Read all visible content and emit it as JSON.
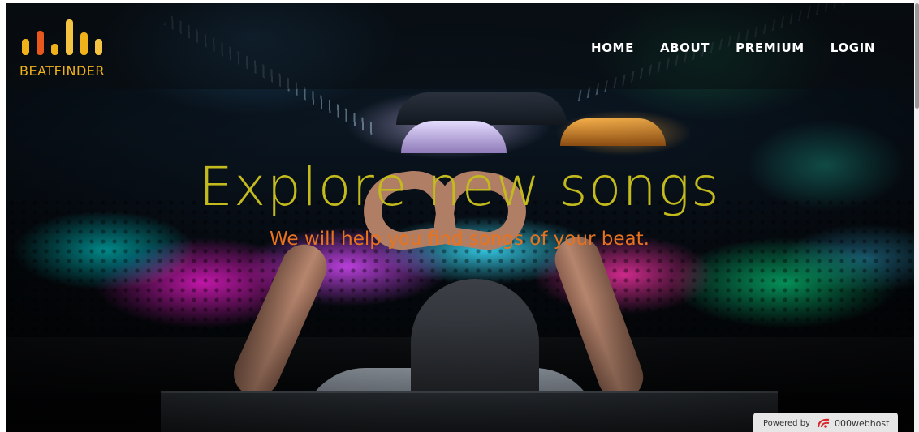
{
  "brand": {
    "name": "BEATFINDER",
    "colors": [
      "#f0b21a",
      "#e8581c",
      "#f0b21a",
      "#f5c342",
      "#f0b21a",
      "#f5c342"
    ],
    "icon": "equalizer-bars-logo"
  },
  "nav": {
    "items": [
      {
        "label": "HOME"
      },
      {
        "label": "ABOUT"
      },
      {
        "label": "PREMIUM"
      },
      {
        "label": "LOGIN"
      }
    ]
  },
  "hero": {
    "title": "Explore new songs",
    "subtitle": "We will help you find songs of your beat.",
    "title_color": "#c3ba1e",
    "subtitle_color": "#e8731e"
  },
  "footer_badge": {
    "label": "Powered by",
    "brand": "000webhost",
    "icon": "webhost-logo-icon"
  }
}
